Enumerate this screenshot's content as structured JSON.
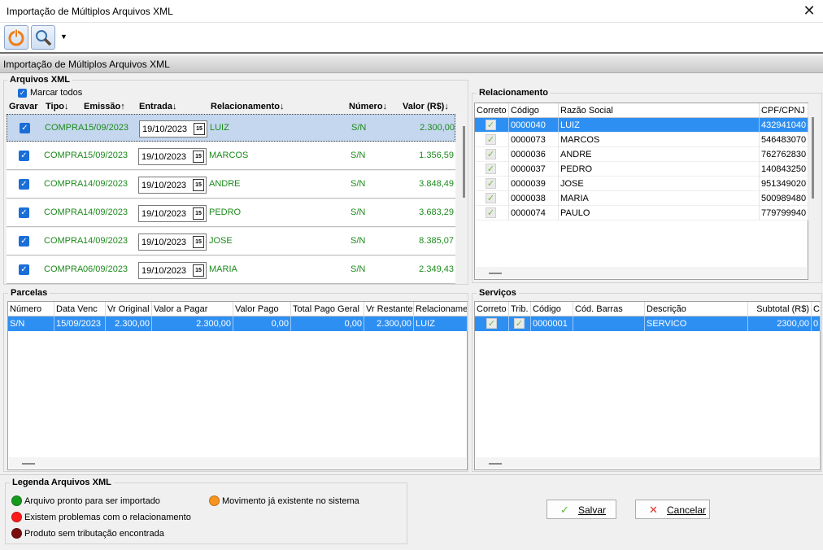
{
  "window": {
    "title": "Importação de Múltiplos Arquivos XML",
    "close": "✕"
  },
  "toolbar": {
    "dropdown": "▼"
  },
  "section_title": "Importação de Múltiplos Arquivos XML",
  "arquivos": {
    "title": "Arquivos XML",
    "marcar_todos": "Marcar todos",
    "check_glyph": "✓",
    "cal_glyph": "15",
    "headers": [
      "Gravar",
      "Tipo↓",
      "Emissão↑",
      "Entrada↓",
      "Relacionamento↓",
      "Número↓",
      "Valor (R$)↓"
    ],
    "rows": [
      {
        "tipo": "COMPRA",
        "emissao": "15/09/2023",
        "entrada": "19/10/2023",
        "relacionamento": "LUIZ",
        "numero": "S/N",
        "valor": "2.300,00"
      },
      {
        "tipo": "COMPRA",
        "emissao": "15/09/2023",
        "entrada": "19/10/2023",
        "relacionamento": "MARCOS",
        "numero": "S/N",
        "valor": "1.356,59"
      },
      {
        "tipo": "COMPRA",
        "emissao": "14/09/2023",
        "entrada": "19/10/2023",
        "relacionamento": "ANDRE",
        "numero": "S/N",
        "valor": "3.848,49"
      },
      {
        "tipo": "COMPRA",
        "emissao": "14/09/2023",
        "entrada": "19/10/2023",
        "relacionamento": "PEDRO",
        "numero": "S/N",
        "valor": "3.683,29"
      },
      {
        "tipo": "COMPRA",
        "emissao": "14/09/2023",
        "entrada": "19/10/2023",
        "relacionamento": "JOSE",
        "numero": "S/N",
        "valor": "8.385,07"
      },
      {
        "tipo": "COMPRA",
        "emissao": "06/09/2023",
        "entrada": "19/10/2023",
        "relacionamento": "MARIA",
        "numero": "S/N",
        "valor": "2.349,43"
      }
    ]
  },
  "relacionamento": {
    "title": "Relacionamento",
    "headers": [
      "Correto",
      "Código",
      "Razão Social",
      "CPF/CPNJ"
    ],
    "rows": [
      {
        "codigo": "0000040",
        "razao": "LUIZ",
        "cpf": "432941040"
      },
      {
        "codigo": "0000073",
        "razao": "MARCOS",
        "cpf": "546483070"
      },
      {
        "codigo": "0000036",
        "razao": "ANDRE",
        "cpf": "762762830"
      },
      {
        "codigo": "0000037",
        "razao": "PEDRO",
        "cpf": "140843250"
      },
      {
        "codigo": "0000039",
        "razao": "JOSE",
        "cpf": "951349020"
      },
      {
        "codigo": "0000038",
        "razao": "MARIA",
        "cpf": "500989480"
      },
      {
        "codigo": "0000074",
        "razao": "PAULO",
        "cpf": "779799940"
      }
    ]
  },
  "parcelas": {
    "title": "Parcelas",
    "headers": [
      "Número",
      "Data Venc",
      "Vr Original",
      "Valor a Pagar",
      "Valor Pago",
      "Total Pago Geral",
      "Vr Restante",
      "Relacionamen"
    ],
    "row": {
      "numero": "S/N",
      "data_venc": "15/09/2023",
      "vr_original": "2.300,00",
      "valor_pagar": "2.300,00",
      "valor_pago": "0,00",
      "total_pago": "0,00",
      "vr_restante": "2.300,00",
      "relacionamento": "LUIZ"
    }
  },
  "servicos": {
    "title": "Serviços",
    "headers": [
      "Correto",
      "Trib.",
      "Código",
      "Cód. Barras",
      "Descrição",
      "Subtotal (R$)",
      "C"
    ],
    "row": {
      "codigo": "0000001",
      "cod_barras": "",
      "descricao": "SERVICO",
      "subtotal": "2300,00",
      "c": "0"
    }
  },
  "legenda": {
    "title": "Legenda Arquivos XML",
    "items": [
      {
        "label": "Arquivo pronto para ser importado",
        "color": "#169a1c"
      },
      {
        "label": "Existem problemas com o relacionamento",
        "color": "#ff1a1a"
      },
      {
        "label": "Produto sem tributação encontrada",
        "color": "#7a0d0d"
      },
      {
        "label": "Movimento já existente no sistema",
        "color": "#f7941d"
      }
    ]
  },
  "buttons": {
    "salvar": "Salvar",
    "cancelar": "Cancelar"
  }
}
